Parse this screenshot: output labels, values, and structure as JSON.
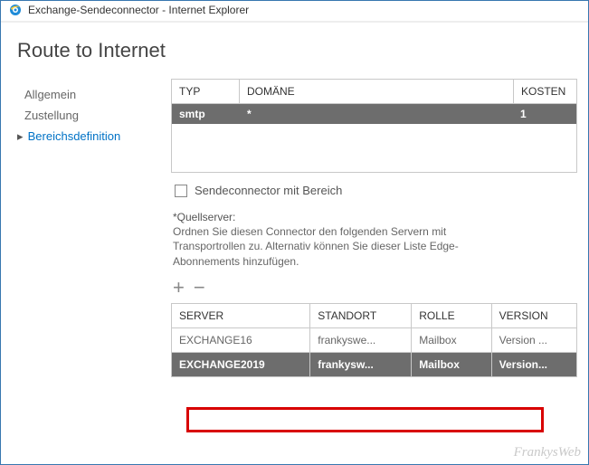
{
  "window": {
    "title": "Exchange-Sendeconnector - Internet Explorer"
  },
  "page": {
    "title": "Route to Internet"
  },
  "nav": {
    "items": [
      {
        "label": "Allgemein"
      },
      {
        "label": "Zustellung"
      },
      {
        "label": "Bereichsdefinition"
      }
    ]
  },
  "domain_table": {
    "headers": {
      "type": "TYP",
      "domain": "DOMÄNE",
      "cost": "KOSTEN"
    },
    "row": {
      "type": "smtp",
      "domain": "*",
      "cost": "1"
    }
  },
  "checkbox": {
    "label": "Sendeconnector mit Bereich"
  },
  "help": {
    "label": "*Quellserver:",
    "text": "Ordnen Sie diesen Connector den folgenden Servern mit Transportrollen zu. Alternativ können Sie dieser Liste Edge-Abonnements hinzufügen."
  },
  "servers_table": {
    "headers": {
      "server": "SERVER",
      "site": "STANDORT",
      "role": "ROLLE",
      "version": "VERSION"
    },
    "rows": [
      {
        "server": "EXCHANGE16",
        "site": "frankyswe...",
        "role": "Mailbox",
        "version": "Version ..."
      },
      {
        "server": "EXCHANGE2019",
        "site": "frankysw...",
        "role": "Mailbox",
        "version": "Version..."
      }
    ]
  },
  "watermark": "FrankysWeb"
}
